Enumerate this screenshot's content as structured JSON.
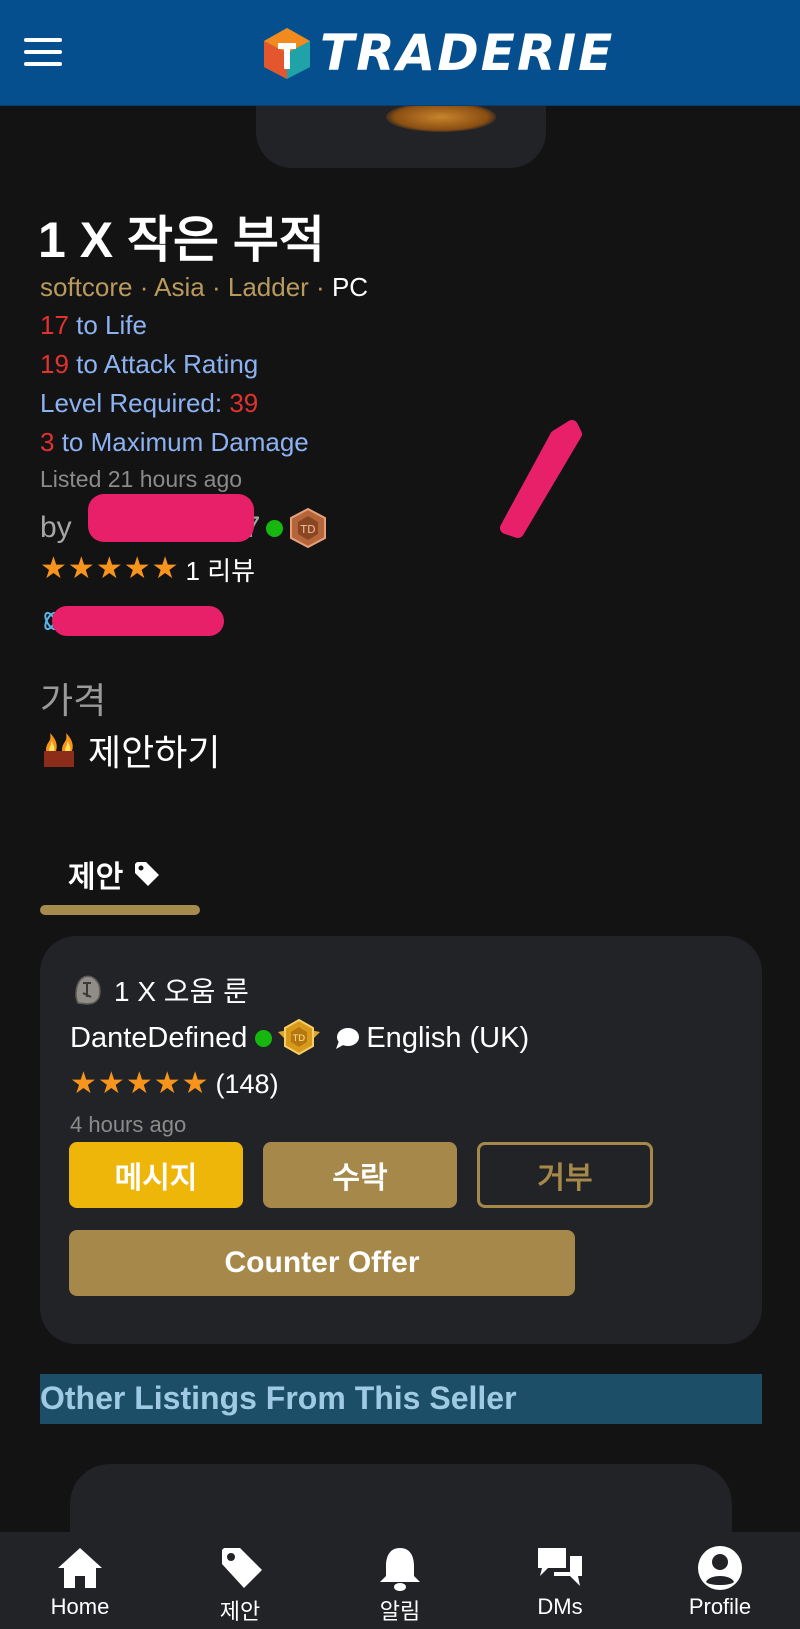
{
  "header": {
    "logo_text": "TRADERIE"
  },
  "listing": {
    "title": "1 X 작은 부적",
    "meta": {
      "mode": "softcore",
      "region": "Asia",
      "ladder": "Ladder",
      "platform": "PC",
      "sep": " · "
    },
    "properties": [
      {
        "num": "17",
        "text": " to Life"
      },
      {
        "num": "19",
        "text": " to Attack Rating"
      },
      {
        "text": "Level Required: ",
        "num": "39"
      },
      {
        "num": "3",
        "text": " to Maximum Damage"
      }
    ],
    "listed": "Listed 21 hours ago",
    "by_prefix": "by",
    "seller_suffix": "7",
    "review_count": "1 리뷰",
    "price_label": "가격",
    "price_value": "제안하기"
  },
  "tabs": {
    "offers_label": "제안"
  },
  "offer": {
    "item": "1 X 오움 룬",
    "user": "DanteDefined",
    "language": "English (UK)",
    "rating_count": "(148)",
    "time": "4 hours ago",
    "buttons": {
      "message": "메시지",
      "accept": "수락",
      "reject": "거부",
      "counter": "Counter Offer"
    }
  },
  "other_listings_title": "Other Listings From This Seller",
  "bottom_nav": [
    {
      "label": "Home"
    },
    {
      "label": "제안"
    },
    {
      "label": "알림"
    },
    {
      "label": "DMs"
    },
    {
      "label": "Profile"
    }
  ],
  "colors": {
    "header_bg": "#064f8f",
    "accent_gold": "#a6894a",
    "message_yellow": "#efb60a",
    "star_orange": "#f7941d",
    "stat_number_red": "#e0322f",
    "stat_text_blue": "#8cb2f1",
    "online_green": "#16b80f",
    "redaction_pink": "#e8206a"
  }
}
